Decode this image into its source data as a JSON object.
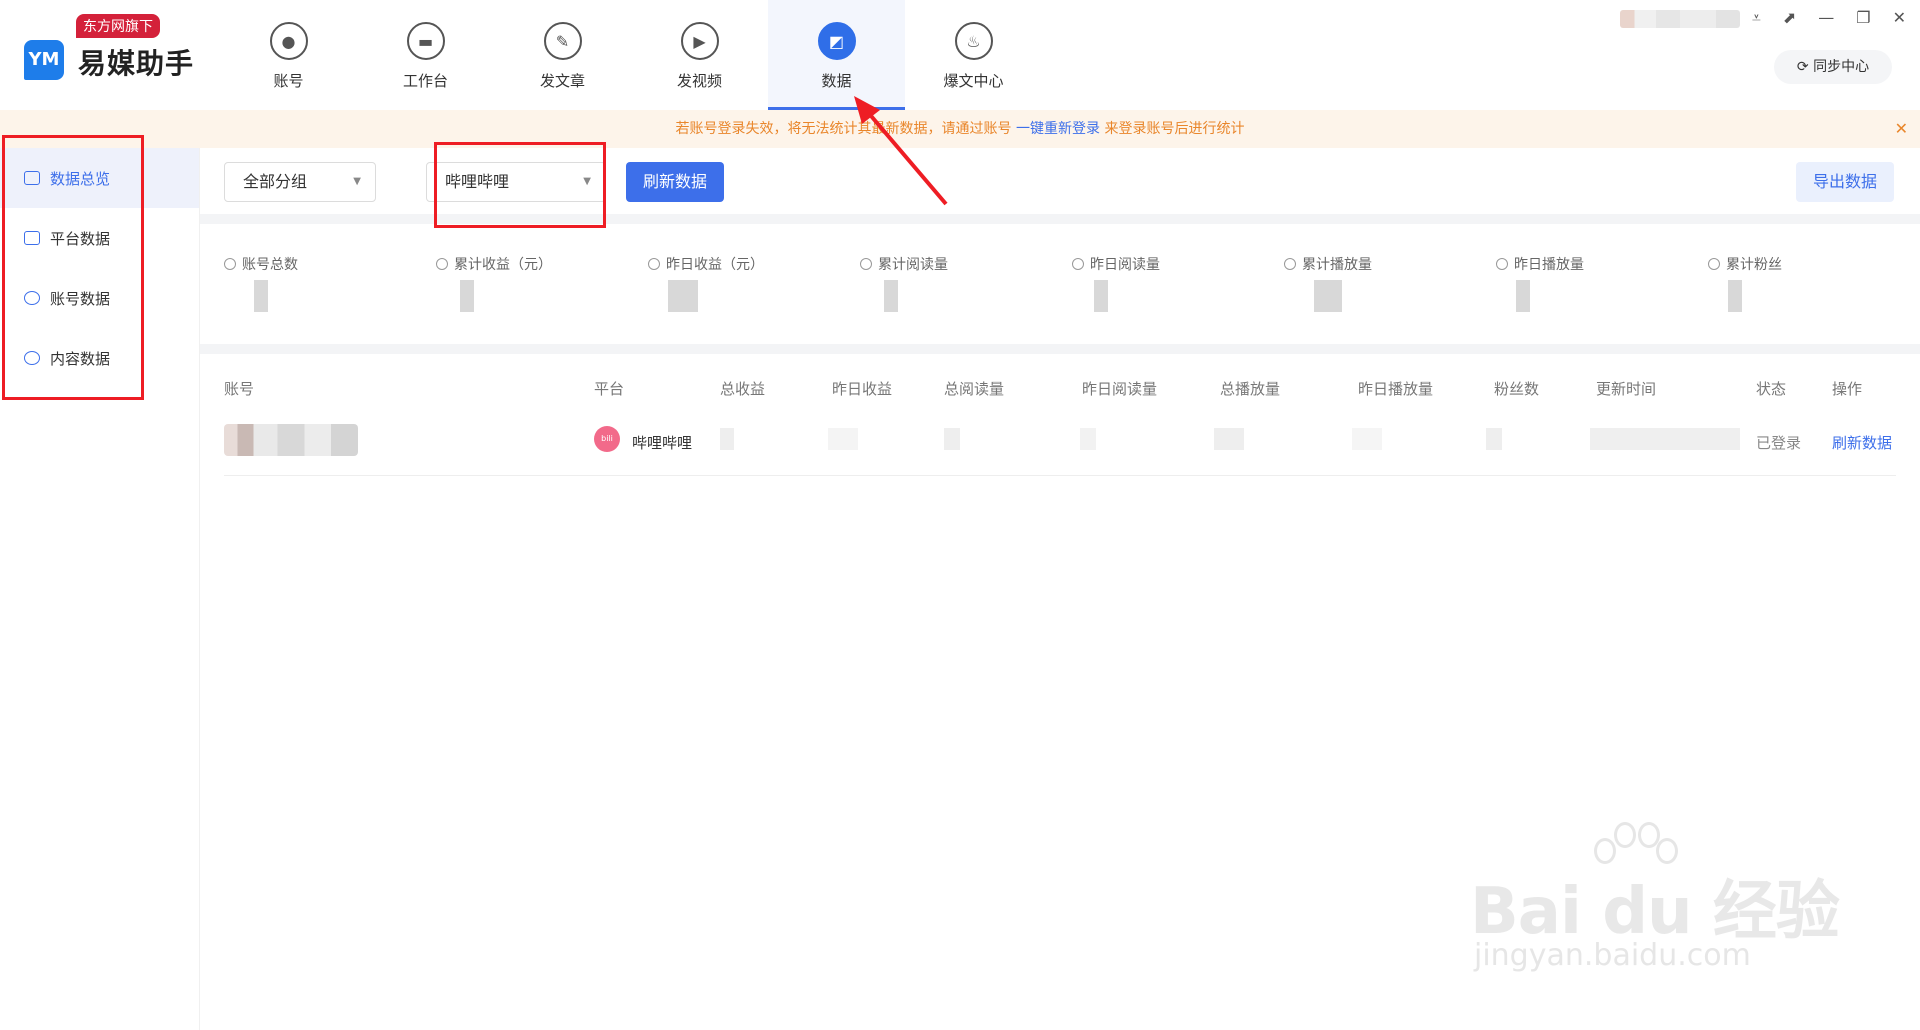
{
  "app": {
    "logo_mark": "YM",
    "name": "易媒助手",
    "badge": "东方网旗下"
  },
  "nav": [
    {
      "label": "账号",
      "icon": "user-icon",
      "glyph": "●"
    },
    {
      "label": "工作台",
      "icon": "monitor-icon",
      "glyph": "▬"
    },
    {
      "label": "发文章",
      "icon": "feather-icon",
      "glyph": "✎"
    },
    {
      "label": "发视频",
      "icon": "play-icon",
      "glyph": "▶"
    },
    {
      "label": "数据",
      "icon": "chart-icon",
      "glyph": "◩",
      "active": true
    },
    {
      "label": "爆文中心",
      "icon": "fire-icon",
      "glyph": "♨"
    }
  ],
  "sync": {
    "label": "同步中心",
    "icon": "sync-icon"
  },
  "notice": {
    "text_before": "若账号登录失效，将无法统计其最新数据，请通过账号",
    "link": "一键重新登录",
    "text_after": "来登录账号后进行统计"
  },
  "sidebar": [
    {
      "label": "数据总览",
      "icon": "overview-icon",
      "active": true
    },
    {
      "label": "平台数据",
      "icon": "platform-icon"
    },
    {
      "label": "账号数据",
      "icon": "account-icon"
    },
    {
      "label": "内容数据",
      "icon": "pie-icon"
    }
  ],
  "toolbar": {
    "group_select": "全部分组",
    "platform_select": "哔哩哔哩",
    "refresh": "刷新数据",
    "export": "导出数据"
  },
  "stats": [
    {
      "label": "账号总数",
      "icon": "user-icon"
    },
    {
      "label": "累计收益（元）",
      "icon": "wallet-icon"
    },
    {
      "label": "昨日收益（元）",
      "icon": "coin-icon"
    },
    {
      "label": "累计阅读量",
      "icon": "doc-icon"
    },
    {
      "label": "昨日阅读量",
      "icon": "eye-icon"
    },
    {
      "label": "累计播放量",
      "icon": "play-circle-icon"
    },
    {
      "label": "昨日播放量",
      "icon": "play-icon"
    },
    {
      "label": "累计粉丝",
      "icon": "fans-icon"
    }
  ],
  "table": {
    "headers": [
      "账号",
      "平台",
      "总收益",
      "昨日收益",
      "总阅读量",
      "昨日阅读量",
      "总播放量",
      "昨日播放量",
      "粉丝数",
      "更新时间",
      "状态",
      "操作"
    ],
    "rows": [
      {
        "platform": "哔哩哔哩",
        "platform_icon": "bilibili-icon",
        "platform_badge": "bili",
        "status": "已登录",
        "action": "刷新数据"
      }
    ]
  },
  "watermark": {
    "brand": "Bai du 经验",
    "url": "jingyan.baidu.com"
  }
}
